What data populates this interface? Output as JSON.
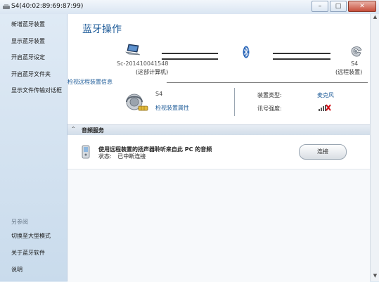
{
  "window": {
    "title": "S4(40:02:89:69:87:99)",
    "minimize": "–",
    "maximize": "□",
    "close": "✕"
  },
  "sidebar": {
    "items": [
      {
        "label": "新增蓝牙装置"
      },
      {
        "label": "显示蓝牙装置"
      },
      {
        "label": "开启蓝牙设定"
      },
      {
        "label": "开启蓝牙文件夹"
      },
      {
        "label": "显示文件传输对话框"
      }
    ],
    "see_also": "另参阅",
    "bottom_items": [
      {
        "label": "切换至大型模式"
      },
      {
        "label": "关于蓝牙软件"
      },
      {
        "label": "说明"
      }
    ]
  },
  "main": {
    "title": "蓝牙操作",
    "computer": {
      "name": "Sc-201410041548",
      "label": "(这部计算机)"
    },
    "device": {
      "name": "S4",
      "label": "(远程装置)"
    },
    "info_link": "检视远程装置信息",
    "detail": {
      "name": "S4",
      "props_link": "检视装置属性",
      "type_key": "装置类型:",
      "type_value": "麦克风",
      "signal_key": "讯号强度:"
    },
    "section": {
      "title": "音频服务",
      "chevron": "⌃"
    },
    "service": {
      "description": "使用远程装置的扬声器聆听来自此 PC 的音频",
      "status_label": "状态:",
      "status_value": "已中断连接",
      "connect_button": "连接"
    }
  },
  "colors": {
    "accent": "#1f5c99",
    "sidebar_bg": "#d6e4f1"
  },
  "icons": [
    "app-icon",
    "laptop-icon",
    "bluetooth-icon",
    "phone-icon",
    "headset-icon",
    "signal-icon",
    "mobile-icon",
    "chevron-up-icon"
  ]
}
